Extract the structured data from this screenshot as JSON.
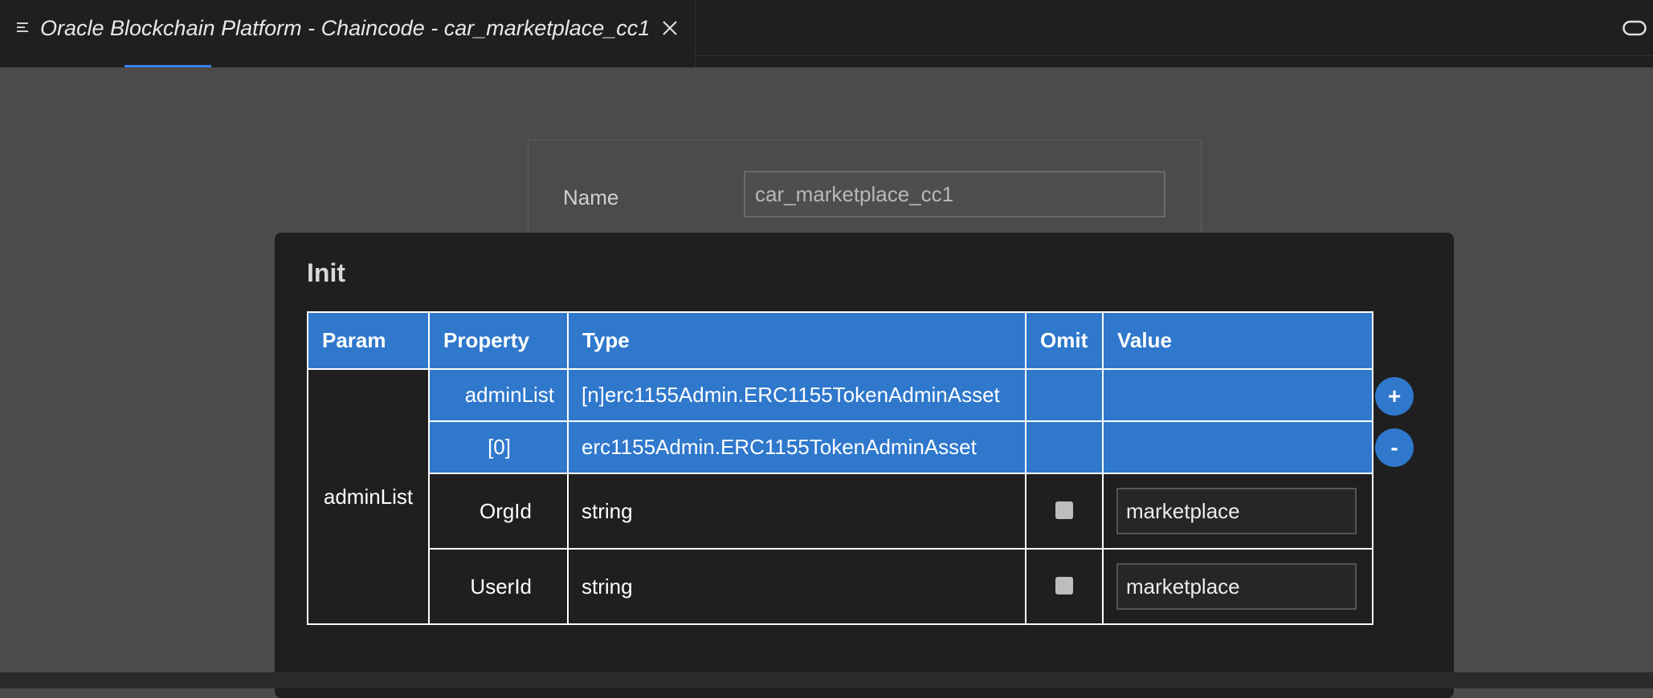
{
  "tab": {
    "title": "Oracle Blockchain Platform - Chaincode - car_marketplace_cc1"
  },
  "form": {
    "name_label": "Name",
    "name_value": "car_marketplace_cc1"
  },
  "dialog": {
    "title": "Init",
    "columns": [
      "Param",
      "Property",
      "Type",
      "Omit",
      "Value"
    ],
    "param_name": "adminList",
    "rows": [
      {
        "property": "adminList",
        "type": "[n]erc1155Admin.ERC1155TokenAdminAsset"
      },
      {
        "property": "[0]",
        "type": "erc1155Admin.ERC1155TokenAdminAsset"
      },
      {
        "property": "OrgId",
        "type": "string",
        "value": "marketplace"
      },
      {
        "property": "UserId",
        "type": "string",
        "value": "marketplace"
      }
    ],
    "add_label": "+",
    "remove_label": "-"
  },
  "colors": {
    "accent": "#2f78cc",
    "dialog_bg": "#1f1f1f",
    "page_bg": "#4b4b4b"
  }
}
